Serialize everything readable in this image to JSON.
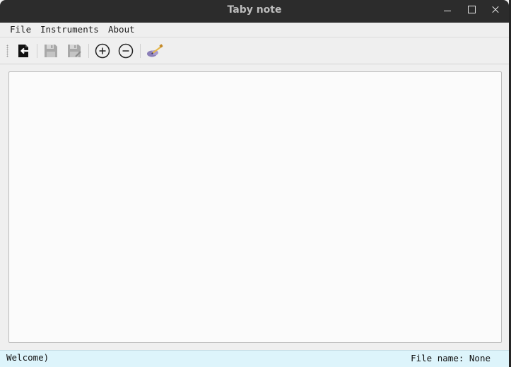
{
  "window": {
    "title": "Taby note"
  },
  "menubar": {
    "items": [
      {
        "label": "File"
      },
      {
        "label": "Instruments"
      },
      {
        "label": "About"
      }
    ]
  },
  "toolbar": {
    "buttons": [
      {
        "icon": "exit-icon",
        "enabled": true
      },
      {
        "icon": "save-icon",
        "enabled": false
      },
      {
        "icon": "save-as-icon",
        "enabled": false
      },
      {
        "icon": "zoom-in-icon",
        "enabled": true
      },
      {
        "icon": "zoom-out-icon",
        "enabled": true
      },
      {
        "icon": "guitar-icon",
        "enabled": true
      }
    ]
  },
  "editor": {
    "content": ""
  },
  "statusbar": {
    "message": "Welcome)",
    "file_name_text": "File name: None"
  },
  "colors": {
    "titlebar": "#2c2c2c",
    "statusbar": "#ddf4fb",
    "editor_bg": "#fbfbfb"
  }
}
